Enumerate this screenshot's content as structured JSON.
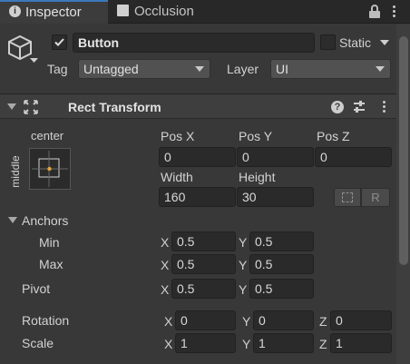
{
  "tabs": [
    {
      "label": "Inspector",
      "icon": "info-icon"
    },
    {
      "label": "Occlusion",
      "icon": "occlusion-icon"
    }
  ],
  "object": {
    "name": "Button",
    "active": true,
    "static_label": "Static",
    "tag_label": "Tag",
    "tag_value": "Untagged",
    "layer_label": "Layer",
    "layer_value": "UI"
  },
  "rect_transform": {
    "title": "Rect Transform",
    "anchor_preset_h": "center",
    "anchor_preset_v": "middle",
    "pos_x_label": "Pos X",
    "pos_y_label": "Pos Y",
    "pos_z_label": "Pos Z",
    "pos_x": "0",
    "pos_y": "0",
    "pos_z": "0",
    "width_label": "Width",
    "height_label": "Height",
    "width": "160",
    "height": "30",
    "raw_edit_label": "R",
    "anchors_label": "Anchors",
    "min_label": "Min",
    "max_label": "Max",
    "pivot_label": "Pivot",
    "rotation_label": "Rotation",
    "scale_label": "Scale",
    "x_label": "X",
    "y_label": "Y",
    "z_label": "Z",
    "min_x": "0.5",
    "min_y": "0.5",
    "max_x": "0.5",
    "max_y": "0.5",
    "pivot_x": "0.5",
    "pivot_y": "0.5",
    "rot_x": "0",
    "rot_y": "0",
    "rot_z": "0",
    "scale_x": "1",
    "scale_y": "1",
    "scale_z": "1"
  },
  "colors": {
    "panel_bg": "#383838",
    "tab_accent": "#3a79bb",
    "field_bg": "#2a2a2a",
    "anchor_dot": "#e7a33a"
  }
}
